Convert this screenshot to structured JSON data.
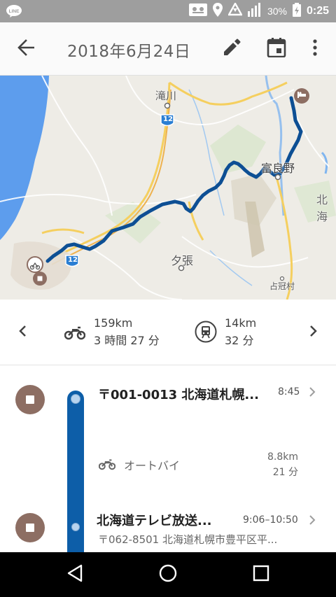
{
  "status_bar": {
    "battery_percent": "30%",
    "time": "0:25",
    "icons": [
      "line-app-icon",
      "voicemail-icon",
      "location-icon",
      "data-saver-icon",
      "signal-icon",
      "battery-charging-icon"
    ]
  },
  "app_bar": {
    "title": "2018年6月24日",
    "icons": [
      "back-arrow-icon",
      "edit-pencil-icon",
      "calendar-icon",
      "more-vert-icon"
    ]
  },
  "map": {
    "labels": {
      "takikawa": "滝川",
      "furano": "富良野",
      "hokkai": "北海",
      "yubari": "夕張",
      "shimukappu": "占冠村",
      "route12_north": "12",
      "route12_south": "12"
    },
    "colors": {
      "route": "#0d4f94",
      "water": "#5d9ded",
      "land": "#eeece6"
    }
  },
  "summary": {
    "motorcycle": {
      "distance": "159km",
      "duration": "3 時間 27 分"
    },
    "train": {
      "distance": "14km",
      "duration": "32 分"
    }
  },
  "timeline": {
    "stops": [
      {
        "name": "〒001-0013 北海道札幌...",
        "time": "8:45"
      },
      {
        "name": "北海道テレビ放送...",
        "time": "9:06–10:50",
        "address": "〒062-8501 北海道札幌市豊平区平..."
      }
    ],
    "segment": {
      "mode": "オートバイ",
      "distance": "8.8km",
      "duration": "21 分"
    },
    "colors": {
      "stop_marker": "#8d6e63",
      "track": "#0d5ea8"
    }
  }
}
